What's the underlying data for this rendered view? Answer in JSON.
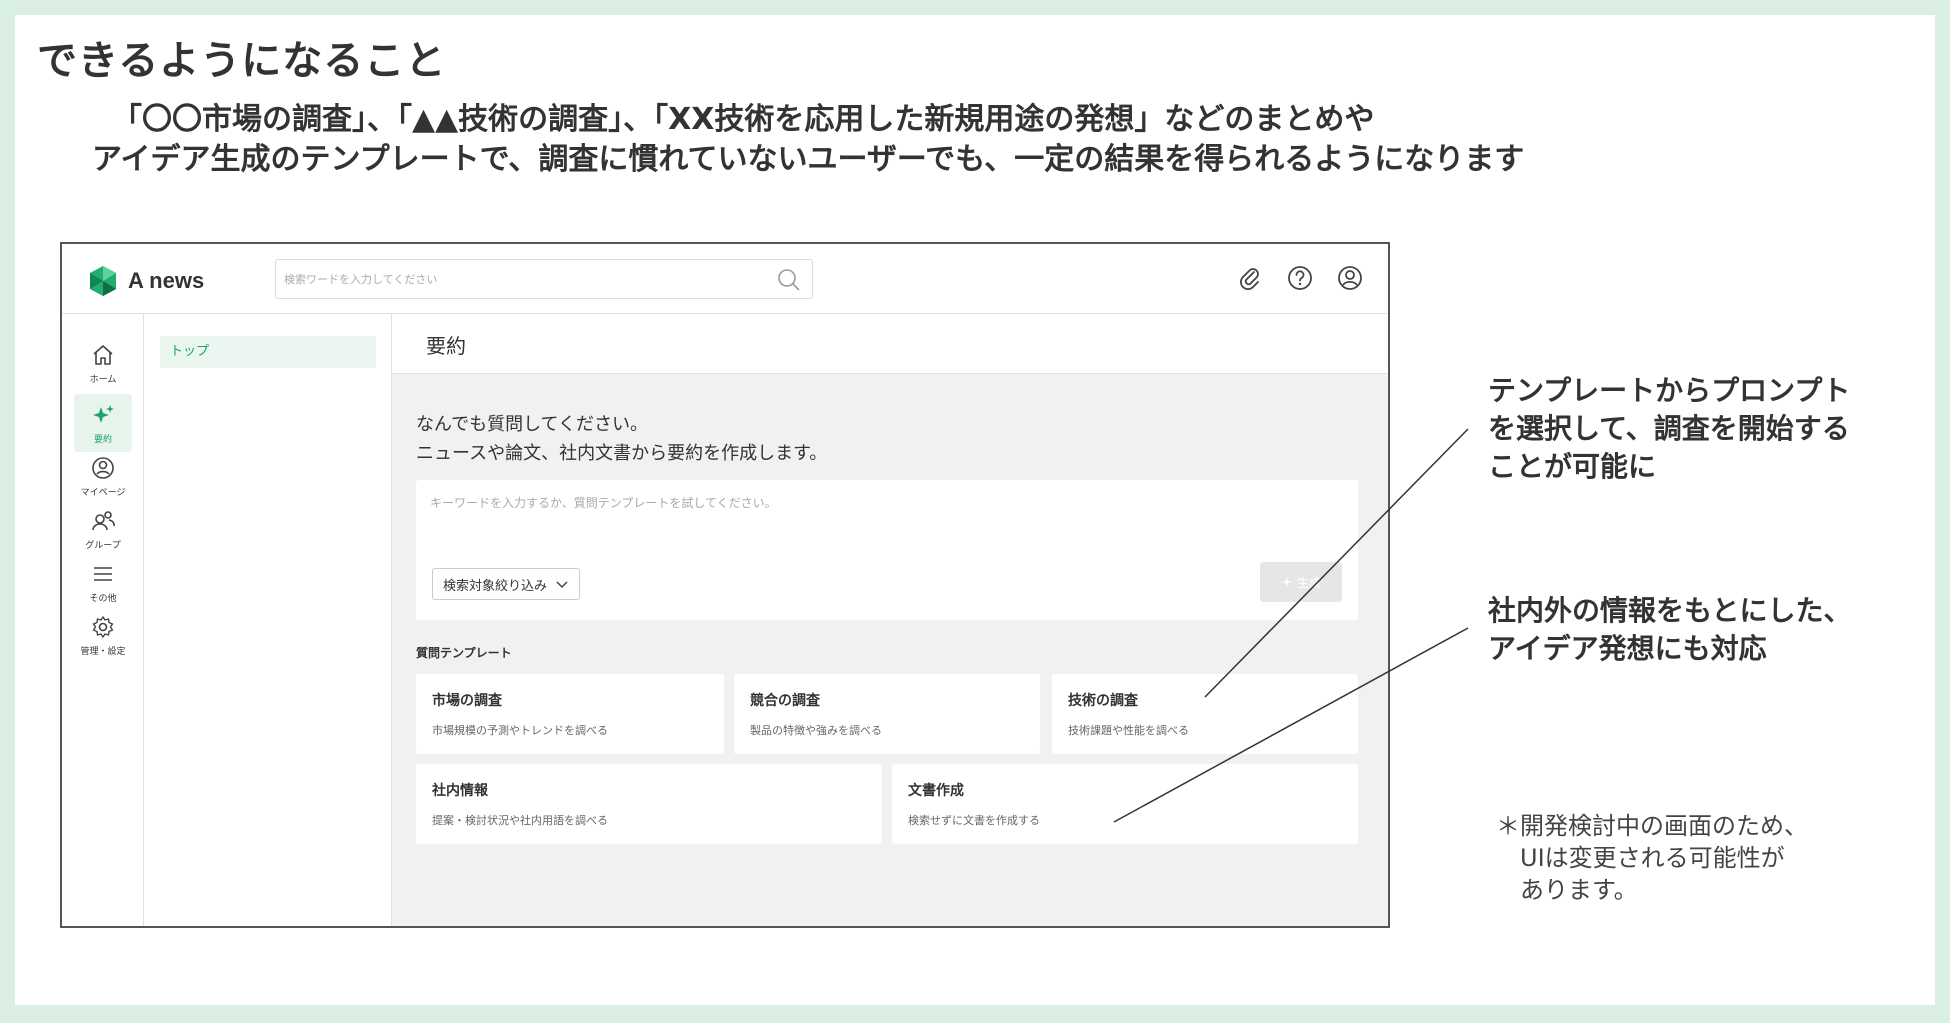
{
  "slide": {
    "title": "できるようになること",
    "lead_line1": "「〇〇市場の調査」、「▲▲技術の調査」、「XX技術を応用した新規用途の発想」などのまとめや",
    "lead_line2": "アイデア生成のテンプレートで、調査に慣れていないユーザーでも、一定の結果を得られるようになります"
  },
  "app": {
    "logo_text": "A news",
    "search_placeholder": "検索ワードを入力してください",
    "top_icons": [
      "paperclip-icon",
      "help-icon",
      "account-icon"
    ],
    "sidenav": [
      {
        "label": "ホーム",
        "icon": "home-icon"
      },
      {
        "label": "要約",
        "icon": "sparkle-icon",
        "active": true
      },
      {
        "label": "マイページ",
        "icon": "user-circle-icon"
      },
      {
        "label": "グループ",
        "icon": "group-icon"
      },
      {
        "label": "その他",
        "icon": "menu-icon"
      },
      {
        "label": "管理・設定",
        "icon": "gear-icon"
      }
    ],
    "subnav_item": "トップ",
    "page_title": "要約",
    "intro_line1": "なんでも質問してください。",
    "intro_line2": "ニュースや論文、社内文書から要約を作成します。",
    "prompt_placeholder": "キーワードを入力するか、質問テンプレートを試してください。",
    "filter_label": "検索対象絞り込み",
    "generate_label": "生成",
    "section_label": "質問テンプレート",
    "templates": [
      {
        "title": "市場の調査",
        "desc": "市場規模の予測やトレンドを調べる"
      },
      {
        "title": "競合の調査",
        "desc": "製品の特徴や強みを調べる"
      },
      {
        "title": "技術の調査",
        "desc": "技術課題や性能を調べる"
      },
      {
        "title": "社内情報",
        "desc": "提案・検討状況や社内用語を調べる"
      },
      {
        "title": "文書作成",
        "desc": "検索せずに文書を作成する"
      }
    ],
    "colors": {
      "accent": "#1aa367",
      "accent_bg": "#eaf6ef",
      "main_bg": "#f1f1f1"
    }
  },
  "annotations": {
    "a1_line1": "テンプレートからプロンプト",
    "a1_line2": "を選択して、調査を開始する",
    "a1_line3": "ことが可能に",
    "a2_line1": "社内外の情報をもとにした、",
    "a2_line2": "アイデア発想にも対応",
    "note_line1": "＊開発検討中の画面のため、",
    "note_line2": "UIは変更される可能性が",
    "note_line3": "あります。"
  }
}
